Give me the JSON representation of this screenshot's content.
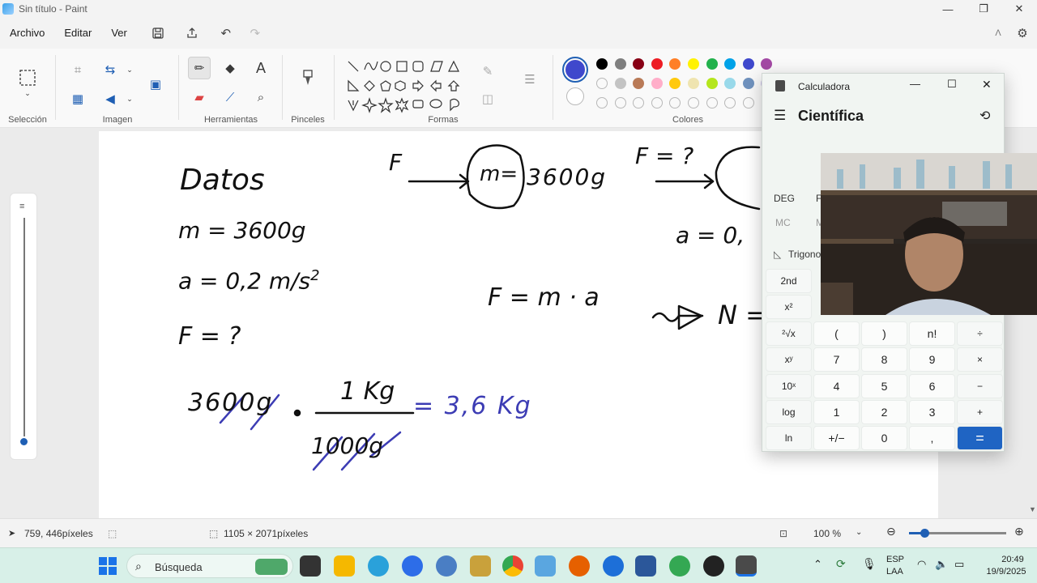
{
  "window": {
    "title": "Sin título - Paint"
  },
  "menu": {
    "items": [
      "Archivo",
      "Editar",
      "Ver"
    ]
  },
  "ribbon": {
    "groups": {
      "seleccion": "Selección",
      "imagen": "Imagen",
      "herramientas": "Herramientas",
      "pinceles": "Pinceles",
      "formas": "Formas",
      "colores": "Colores"
    }
  },
  "palette": {
    "row1": [
      "#000000",
      "#7f7f7f",
      "#880015",
      "#ed1c24",
      "#ff7f27",
      "#fff200",
      "#22b14c",
      "#00a2e8",
      "#3f48cc",
      "#a349a4"
    ],
    "row2": [
      "",
      "#c3c3c3",
      "#b97a57",
      "#ffaec9",
      "#ffc90e",
      "#efe4b0",
      "#b5e61d",
      "#99d9ea",
      "#7092be",
      "#c8bfe7"
    ],
    "primary": "#3f48cc"
  },
  "canvas_text": {
    "datos": "Datos",
    "m": "m = 3600g",
    "a": "a = 0,2 m/s",
    "a_exp": "2",
    "f": "F = ?",
    "diagram_f": "F",
    "diagram_block": "m=",
    "diagram_mass": "3600g",
    "diagram_f2": "F = ?",
    "a_right": "a = 0,",
    "formula": "F = m · a",
    "arrow_n": "N =",
    "conv_left": "3600g",
    "conv_top": "1 Kg",
    "conv_bottom": "1000g",
    "conv_result": "= 3,6 Kg"
  },
  "status": {
    "cursor": "759, 446píxeles",
    "size": "1105 × 2071píxeles",
    "zoom": "100 %"
  },
  "calculator": {
    "title": "Calculadora",
    "mode": "Científica",
    "deg": "DEG",
    "deg_next": "F",
    "mc": "MC",
    "mnext": "M",
    "trig": "Trigono",
    "rows": [
      [
        "2nd",
        "",
        "",
        "",
        ""
      ],
      [
        "x²",
        "",
        "",
        "",
        ""
      ],
      [
        "²√x",
        "(",
        ")",
        "n!",
        "÷"
      ],
      [
        "xʸ",
        "7",
        "8",
        "9",
        "×"
      ],
      [
        "10ˣ",
        "4",
        "5",
        "6",
        "−"
      ],
      [
        "log",
        "1",
        "2",
        "3",
        "+"
      ],
      [
        "ln",
        "+/−",
        "0",
        ",",
        "="
      ]
    ]
  },
  "taskbar": {
    "search_placeholder": "Búsqueda",
    "lang1": "ESP",
    "lang2": "LAA",
    "time": "20:49",
    "date": "19/9/2025"
  }
}
